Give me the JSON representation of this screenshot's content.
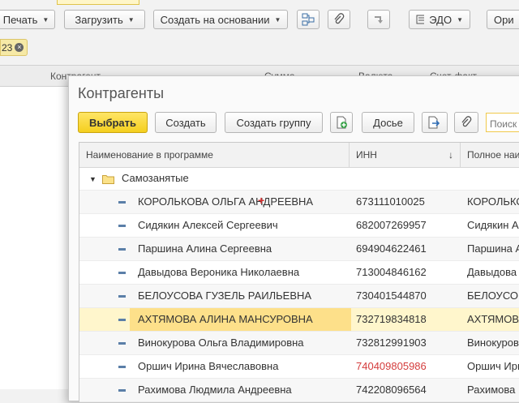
{
  "toolbar": {
    "print_label": "Печать",
    "load_label": "Загрузить",
    "create_based_label": "Создать на основании",
    "edo_label": "ЭДО",
    "more_label": "Ори"
  },
  "filter_chip": {
    "text": "23"
  },
  "background_table": {
    "columns": [
      "Контрагент",
      "Сумма",
      "Валюта",
      "Счет-факт..."
    ]
  },
  "dialog": {
    "title": "Контрагенты",
    "buttons": {
      "select": "Выбрать",
      "create": "Создать",
      "create_group": "Создать группу",
      "dossier": "Досье"
    },
    "search_placeholder": "Поиск (",
    "columns": {
      "name": "Наименование в программе",
      "inn": "ИНН",
      "full_name": "Полное наи"
    },
    "group": {
      "name": "Самозанятые"
    },
    "rows": [
      {
        "name": "КОРОЛЬКОВА ОЛЬГА АНДРЕЕВНА",
        "inn": "673111010025",
        "full": "КОРОЛЬКОВ"
      },
      {
        "name": "Сидякин Алексей Сергеевич",
        "inn": "682007269957",
        "full": "Сидякин А"
      },
      {
        "name": "Паршина Алина Сергеевна",
        "inn": "694904622461",
        "full": "Паршина А"
      },
      {
        "name": "Давыдова Вероника Николаевна",
        "inn": "713004846162",
        "full": "Давыдова"
      },
      {
        "name": "БЕЛОУСОВА ГУЗЕЛЬ РАИЛЬЕВНА",
        "inn": "730401544870",
        "full": "БЕЛОУСОВ"
      },
      {
        "name": "АХТЯМОВА АЛИНА МАНСУРОВНА",
        "inn": "732719834818",
        "full": "АХТЯМОВА"
      },
      {
        "name": "Винокурова Ольга Владимировна",
        "inn": "732812991903",
        "full": "Винокурова"
      },
      {
        "name": "Оршич Ирина Вячеславовна",
        "inn": "740409805986",
        "full": "Оршич Ири"
      },
      {
        "name": "Рахимова Людмила Андреевна",
        "inn": "742208096564",
        "full": "Рахимова"
      }
    ],
    "selected_row": 5,
    "highlight_inn_row": 7,
    "highlight_color": "#d43c3c",
    "accent_color": "#f4cf1e"
  }
}
